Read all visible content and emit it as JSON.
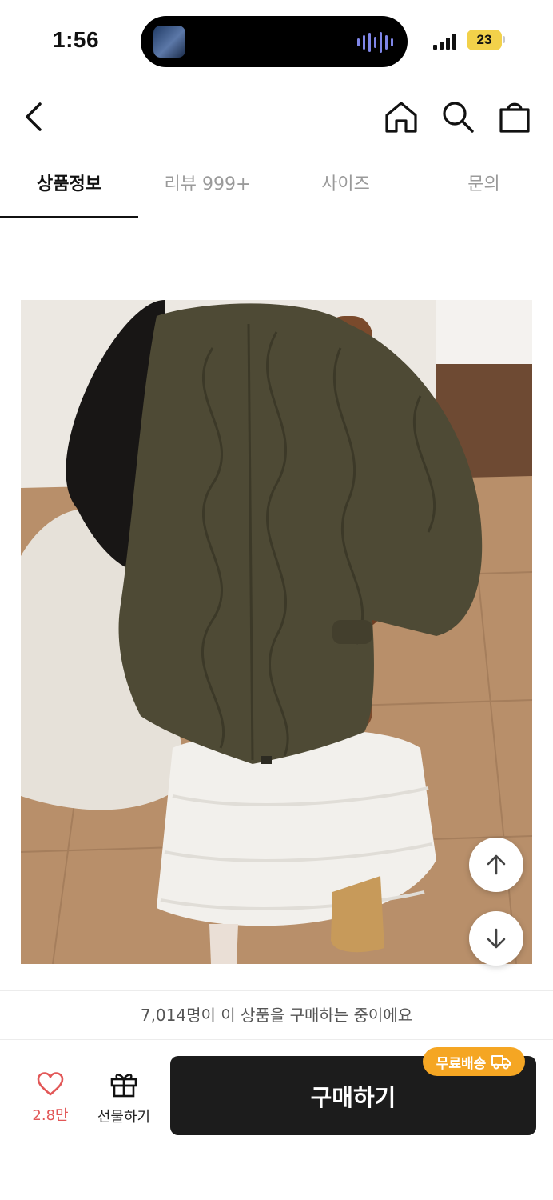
{
  "status_bar": {
    "time": "1:56",
    "battery": "23"
  },
  "nav": {
    "icons": [
      "chevron-left-icon",
      "home-icon",
      "search-icon",
      "shopping-bag-icon"
    ]
  },
  "tabs": [
    {
      "label": "상품정보",
      "active": true
    },
    {
      "label": "리뷰 999+",
      "active": false
    },
    {
      "label": "사이즈",
      "active": false
    },
    {
      "label": "문의",
      "active": false
    }
  ],
  "product": {
    "image_alt": "product-photo"
  },
  "purchase_banner": "7,014명이 이 상품을 구매하는 중이에요",
  "bottom_bar": {
    "like_count": "2.8만",
    "gift_label": "선물하기",
    "buy_label": "구매하기",
    "shipping_badge": "무료배송"
  },
  "colors": {
    "accent_like": "#e25757",
    "badge": "#f5a623",
    "buy_button": "#1c1c1c"
  }
}
